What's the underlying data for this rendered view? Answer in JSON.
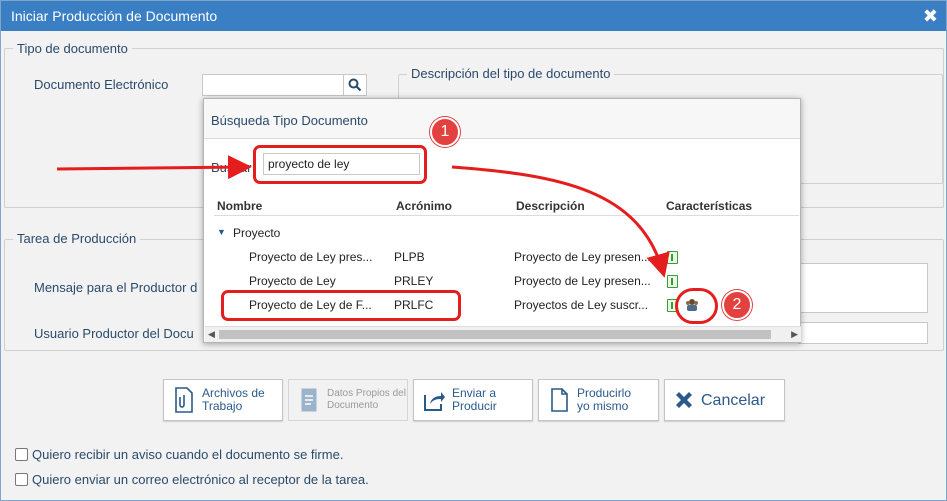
{
  "window": {
    "title": "Iniciar Producción de Documento"
  },
  "tipo_documento": {
    "legend": "Tipo de documento",
    "doc_label": "Documento Electrónico",
    "doc_value": "",
    "descripcion_legend": "Descripción del tipo de documento"
  },
  "popup": {
    "title": "Búsqueda Tipo Documento",
    "search_label": "Buscar",
    "search_value": "proyecto de ley",
    "columns": {
      "nombre": "Nombre",
      "acronimo": "Acrónimo",
      "descripcion": "Descripción",
      "caracteristicas": "Características"
    },
    "group": "Proyecto",
    "rows": [
      {
        "nombre": "Proyecto de Ley pres...",
        "acronimo": "PLPB",
        "descripcion": "Proyecto de Ley presen..."
      },
      {
        "nombre": "Proyecto de Ley",
        "acronimo": "PRLEY",
        "descripcion": "Proyecto de Ley presen..."
      },
      {
        "nombre": "Proyecto de Ley de F...",
        "acronimo": "PRLFC",
        "descripcion": "Proyectos de Ley suscr..."
      }
    ]
  },
  "tarea": {
    "legend": "Tarea de Producción",
    "mensaje_label": "Mensaje para el Productor d",
    "usuario_label": "Usuario Productor del Docu"
  },
  "buttons": {
    "archivos": "Archivos de\nTrabajo",
    "datos": "Datos Propios del\nDocumento",
    "enviar": "Enviar a\nProducir",
    "producir": "Producirlo\nyo mismo",
    "cancelar": "Cancelar"
  },
  "checks": {
    "aviso": "Quiero recibir un aviso cuando el documento se firme.",
    "correo": "Quiero enviar un correo electrónico al receptor de la tarea."
  },
  "annotations": {
    "badge1": "1",
    "badge2": "2"
  },
  "colors": {
    "titlebar": "#3a7fc4",
    "callout": "#e41d1d",
    "badge": "#e34040",
    "icon_green": "#3a9b3a"
  }
}
